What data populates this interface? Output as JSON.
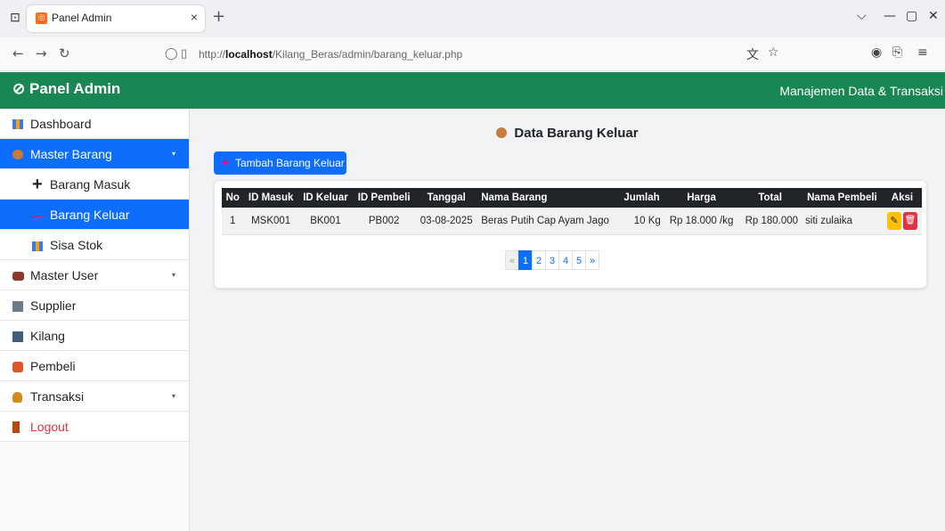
{
  "browser": {
    "tab_title": "Panel Admin",
    "tab_close": "×",
    "new_tab": "+",
    "url_prefix": "http://",
    "url_host": "localhost",
    "url_path": "/Kilang_Beras/admin/barang_keluar.php"
  },
  "header": {
    "brand": "Panel Admin",
    "subtitle": "Manajemen Data & Transaksi",
    "accent": "#198754"
  },
  "sidebar": {
    "items": [
      {
        "label": "Dashboard",
        "icon": "bar-chart-icon"
      },
      {
        "label": "Master Barang",
        "icon": "box-icon",
        "caret": "▾"
      },
      {
        "label": "Barang Masuk",
        "icon": "plus-icon",
        "glyph": "+"
      },
      {
        "label": "Barang Keluar",
        "icon": "minus-icon",
        "glyph": "—"
      },
      {
        "label": "Sisa Stok",
        "icon": "bar-chart-icon"
      },
      {
        "label": "Master User",
        "icon": "people-icon",
        "caret": "▾"
      },
      {
        "label": "Supplier",
        "icon": "factory-icon"
      },
      {
        "label": "Kilang",
        "icon": "books-icon"
      },
      {
        "label": "Pembeli",
        "icon": "couple-icon"
      },
      {
        "label": "Transaksi",
        "icon": "money-bag-icon",
        "caret": "▾"
      },
      {
        "label": "Logout",
        "icon": "door-icon"
      }
    ]
  },
  "main": {
    "title": "Data Barang Keluar",
    "add_button": "Tambah Barang Keluar",
    "add_glyph": "+"
  },
  "table": {
    "columns": [
      "No",
      "ID Masuk",
      "ID Keluar",
      "ID Pembeli",
      "Tanggal",
      "Nama Barang",
      "Jumlah",
      "Harga",
      "Total",
      "Nama Pembeli",
      "Aksi"
    ],
    "rows": [
      [
        "1",
        "MSK001",
        "BK001",
        "PB002",
        "03-08-2025",
        "Beras Putih Cap Ayam Jago",
        "10 Kg",
        "Rp 18.000 /kg",
        "Rp 180.000",
        "siti zulaika"
      ]
    ]
  },
  "pagination": {
    "prev": "«",
    "pages": [
      "1",
      "2",
      "3",
      "4",
      "5"
    ],
    "next": "»",
    "active": "1"
  }
}
